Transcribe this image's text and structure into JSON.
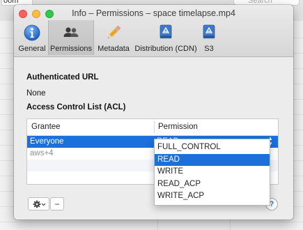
{
  "background": {
    "search_placeholder": "Search",
    "path_text": "oom"
  },
  "window": {
    "title": "Info – Permissions – space timelapse.mp4"
  },
  "toolbar": {
    "tabs": [
      {
        "label": "General",
        "icon": "info-icon",
        "selected": false
      },
      {
        "label": "Permissions",
        "icon": "users-icon",
        "selected": true
      },
      {
        "label": "Metadata",
        "icon": "pencil-icon",
        "selected": false
      },
      {
        "label": "Distribution (CDN)",
        "icon": "cdn-bucket-icon",
        "selected": false
      },
      {
        "label": "S3",
        "icon": "s3-bucket-icon",
        "selected": false
      }
    ]
  },
  "permissions": {
    "authenticated_url_label": "Authenticated URL",
    "authenticated_url_value": "None",
    "acl_label": "Access Control List (ACL)",
    "table": {
      "columns": [
        "Grantee",
        "Permission"
      ],
      "rows": [
        {
          "grantee": "Everyone",
          "permission": "READ",
          "selected": true
        },
        {
          "grantee": "aws+4",
          "permission": "",
          "selected": false
        }
      ]
    },
    "dropdown_options": [
      "FULL_CONTROL",
      "READ",
      "WRITE",
      "READ_ACP",
      "WRITE_ACP"
    ],
    "dropdown_selected": "READ",
    "minus_label": "−",
    "help_label": "?"
  },
  "colors": {
    "selection": "#1d6fdc",
    "close": "#fc605c",
    "minimize": "#fdbc40",
    "maximize": "#34c84a"
  }
}
